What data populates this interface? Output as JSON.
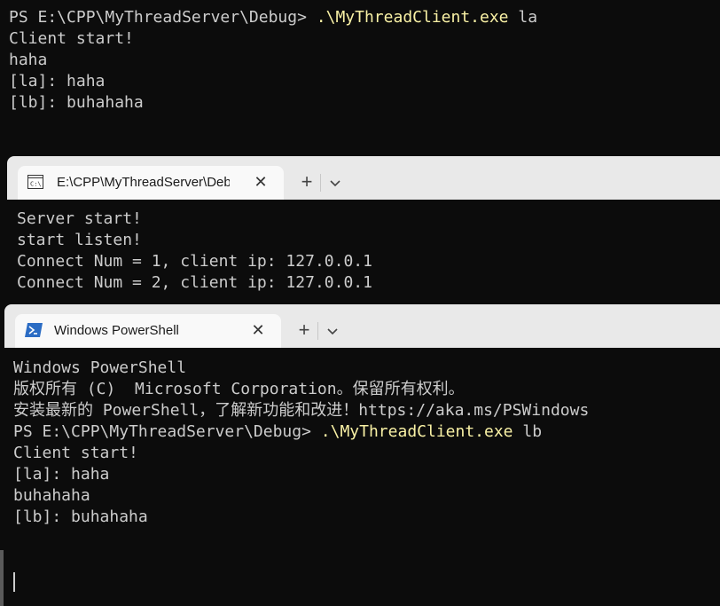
{
  "term1": {
    "lines": [
      {
        "prefix": "PS E:\\CPP\\MyThreadServer\\Debug> ",
        "cmd": ".\\MyThreadClient.exe",
        "arg": " la"
      },
      "Client start!",
      "haha",
      "[la]: haha",
      "[lb]: buhahaha"
    ]
  },
  "win2": {
    "tab_title": "E:\\CPP\\MyThreadServer\\Debug\\MyThreadServer.exe",
    "tab_icon": "console-icon",
    "close_glyph": "✕",
    "newtab_glyph": "+",
    "lines": [
      "Server start!",
      "start listen!",
      "Connect Num = 1, client ip: 127.0.0.1",
      "Connect Num = 2, client ip: 127.0.0.1"
    ]
  },
  "win3": {
    "tab_title": "Windows PowerShell",
    "tab_icon": "powershell-icon",
    "close_glyph": "✕",
    "newtab_glyph": "+",
    "lines": [
      "Windows PowerShell",
      "版权所有 (C)  Microsoft Corporation。保留所有权利。",
      "",
      "安装最新的 PowerShell，了解新功能和改进！https://aka.ms/PSWindows",
      "",
      {
        "prefix": "PS E:\\CPP\\MyThreadServer\\Debug> ",
        "cmd": ".\\MyThreadClient.exe",
        "arg": " lb"
      },
      "Client start!",
      "[la]: haha",
      "buhahaha",
      "[lb]: buhahaha"
    ]
  },
  "colors": {
    "terminal_bg": "#0c0c0c",
    "text": "#cccccc",
    "command": "#f9f1a5",
    "tabbar": "#e9e9e9"
  }
}
